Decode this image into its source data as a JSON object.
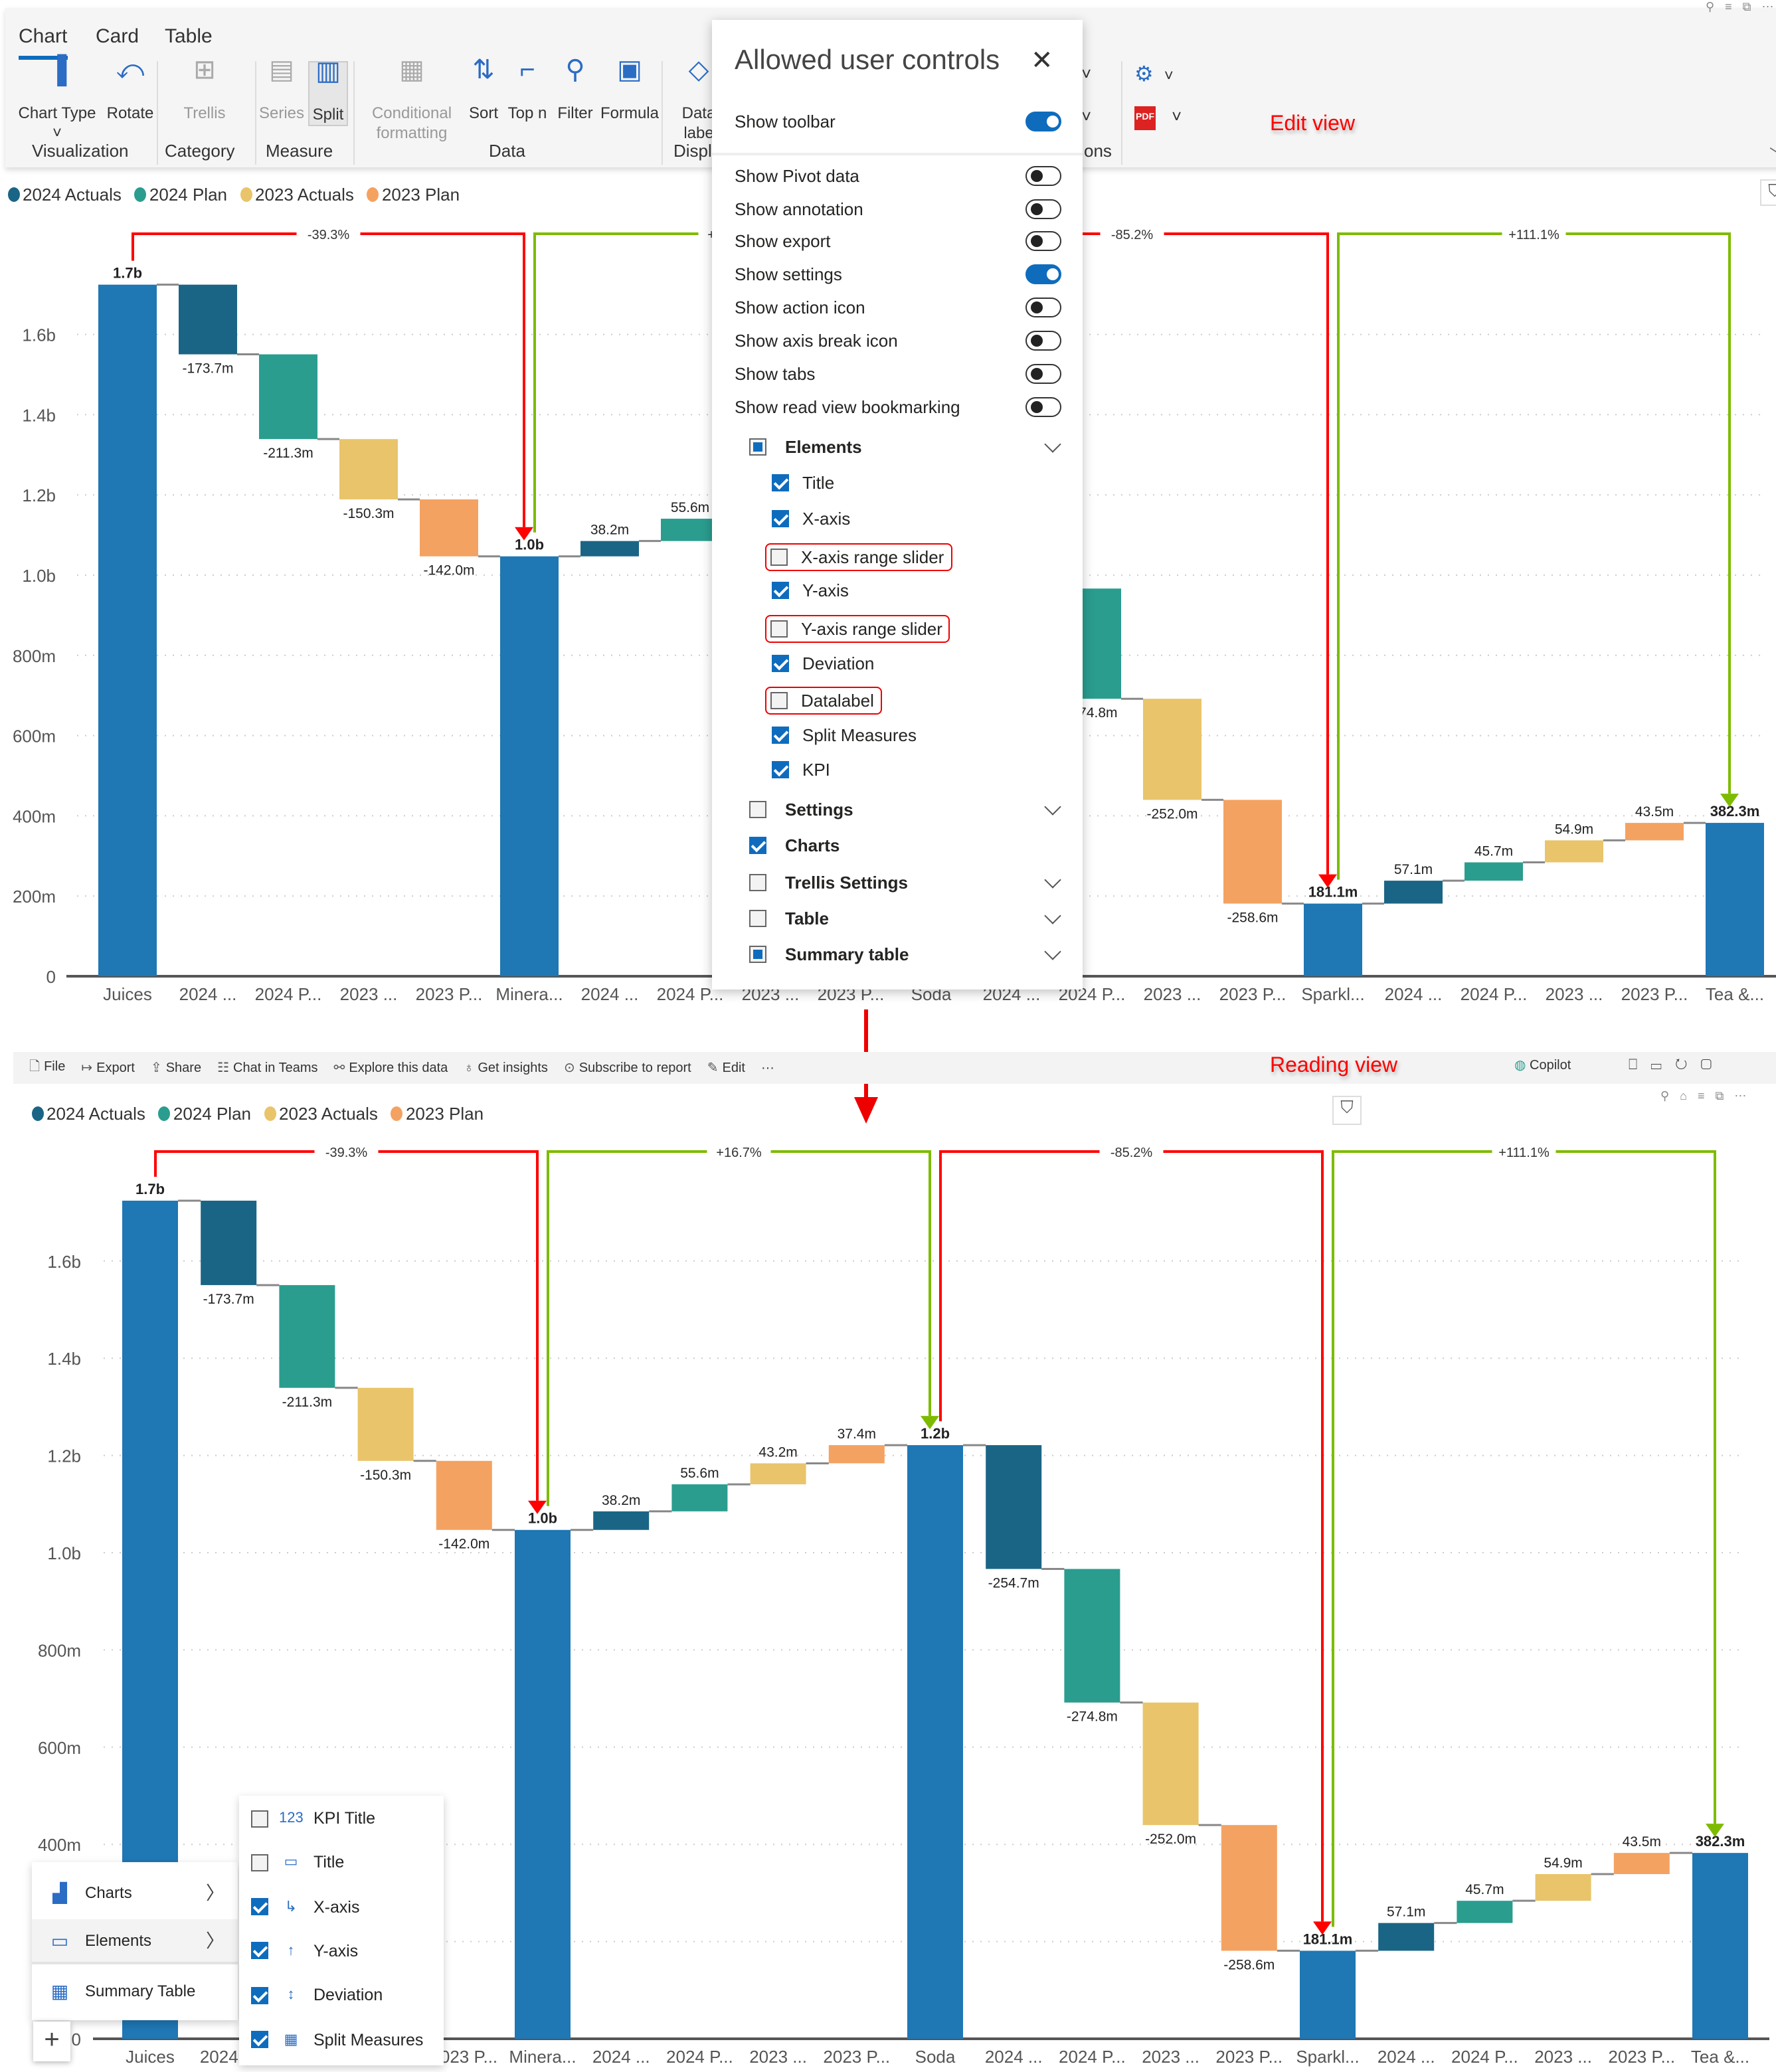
{
  "ribbon": {
    "tabs": [
      "Chart",
      "Card",
      "Table"
    ],
    "active_tab": "Chart",
    "buttons": [
      {
        "label": "Chart Type",
        "icon": "bar-chart-icon",
        "disabled": false
      },
      {
        "label": "Rotate",
        "icon": "rotate-icon",
        "disabled": false
      },
      {
        "label": "Trellis",
        "icon": "trellis-icon",
        "disabled": true
      },
      {
        "label": "Series",
        "icon": "series-icon",
        "disabled": true
      },
      {
        "label": "Split",
        "icon": "split-icon",
        "disabled": false
      },
      {
        "label": "Conditional formatting",
        "icon": "conditional-formatting-icon",
        "disabled": true
      },
      {
        "label": "Sort",
        "icon": "sort-icon",
        "disabled": false
      },
      {
        "label": "Top n",
        "icon": "top-n-icon",
        "disabled": false
      },
      {
        "label": "Filter",
        "icon": "filter-icon",
        "disabled": false
      },
      {
        "label": "Formula",
        "icon": "formula-icon",
        "disabled": false
      },
      {
        "label": "Data labe",
        "icon": "data-label-icon",
        "disabled": false
      }
    ],
    "groups": [
      "Visualization",
      "Category",
      "Measure",
      "Data",
      "Displ",
      "ons"
    ],
    "edit_view_label": "Edit view"
  },
  "legend": [
    {
      "name": "2024 Actuals",
      "color": "#1A6585"
    },
    {
      "name": "2024 Plan",
      "color": "#2A9D8F"
    },
    {
      "name": "2023 Actuals",
      "color": "#E9C46A"
    },
    {
      "name": "2023 Plan",
      "color": "#F4A261"
    }
  ],
  "panel": {
    "title": "Allowed user controls",
    "toggles": [
      {
        "label": "Show toolbar",
        "on": true
      },
      {
        "label": "Show Pivot data",
        "on": false
      },
      {
        "label": "Show annotation",
        "on": false
      },
      {
        "label": "Show export",
        "on": false
      },
      {
        "label": "Show settings",
        "on": true
      },
      {
        "label": "Show action icon",
        "on": false
      },
      {
        "label": "Show axis break icon",
        "on": false
      },
      {
        "label": "Show tabs",
        "on": false
      },
      {
        "label": "Show read view bookmarking",
        "on": false
      }
    ],
    "elements_label": "Elements",
    "elements": [
      {
        "label": "Title",
        "checked": true,
        "highlight": false
      },
      {
        "label": "X-axis",
        "checked": true,
        "highlight": false
      },
      {
        "label": "X-axis range slider",
        "checked": false,
        "highlight": true
      },
      {
        "label": "Y-axis",
        "checked": true,
        "highlight": false
      },
      {
        "label": "Y-axis range slider",
        "checked": false,
        "highlight": true
      },
      {
        "label": "Deviation",
        "checked": true,
        "highlight": false
      },
      {
        "label": "Datalabel",
        "checked": false,
        "highlight": true
      },
      {
        "label": "Split Measures",
        "checked": true,
        "highlight": false
      },
      {
        "label": "KPI",
        "checked": true,
        "highlight": false
      }
    ],
    "sections": [
      {
        "label": "Settings",
        "state": "off",
        "chevron": true
      },
      {
        "label": "Charts",
        "state": "on",
        "chevron": false
      },
      {
        "label": "Trellis Settings",
        "state": "off",
        "chevron": true
      },
      {
        "label": "Table",
        "state": "off",
        "chevron": true
      },
      {
        "label": "Summary table",
        "state": "part",
        "chevron": true
      }
    ]
  },
  "reading_toolbar": {
    "items": [
      "File",
      "Export",
      "Share",
      "Chat in Teams",
      "Explore this data",
      "Get insights",
      "Subscribe to report",
      "Edit",
      "···"
    ],
    "copilot": "Copilot",
    "reading_view_label": "Reading view"
  },
  "context_menu": {
    "items": [
      {
        "label": "Charts",
        "icon": "bar-chart-icon"
      },
      {
        "label": "Elements",
        "icon": "elements-icon"
      },
      {
        "label": "Summary Table",
        "icon": "summary-table-icon"
      }
    ],
    "active": "Elements",
    "submenu": [
      {
        "label": "KPI Title",
        "checked": false,
        "icon": "kpi-icon",
        "glyph": "123"
      },
      {
        "label": "Title",
        "checked": false,
        "icon": "title-icon",
        "glyph": "▭"
      },
      {
        "label": "X-axis",
        "checked": true,
        "icon": "x-axis-icon",
        "glyph": "↳"
      },
      {
        "label": "Y-axis",
        "checked": true,
        "icon": "y-axis-icon",
        "glyph": "↑"
      },
      {
        "label": "Deviation",
        "checked": true,
        "icon": "deviation-icon",
        "glyph": "↕"
      },
      {
        "label": "Split Measures",
        "checked": true,
        "icon": "split-icon",
        "glyph": "▦"
      }
    ],
    "add_label": "+"
  },
  "chart_data": [
    {
      "type": "bar",
      "subtype": "waterfall",
      "view": "edit",
      "categories": [
        "Juices",
        "2024 ...",
        "2024 P...",
        "2023 ...",
        "2023 P...",
        "Minera...",
        "2024 ...",
        "2024 P...",
        "2023 ...",
        "2023 P...",
        "Soda",
        "2024 ...",
        "2024 P...",
        "2023 ...",
        "2023 P...",
        "Sparkl...",
        "2024 ...",
        "2024 P...",
        "2023 ...",
        "2023 P...",
        "Tea &..."
      ],
      "kinds": [
        "total",
        "2024 Actuals",
        "2024 Plan",
        "2023 Actuals",
        "2023 Plan",
        "total",
        "2024 Actuals",
        "2024 Plan",
        "2023 Actuals",
        "2023 Plan",
        "total",
        "2024 Actuals",
        "2024 Plan",
        "2023 Actuals",
        "2023 Plan",
        "total",
        "2024 Actuals",
        "2024 Plan",
        "2023 Actuals",
        "2023 Plan",
        "total"
      ],
      "values": [
        1724.1,
        -173.7,
        -211.3,
        -150.3,
        -142.0,
        1046.8,
        38.2,
        55.6,
        43.2,
        37.4,
        1221.2,
        -254.7,
        -274.8,
        -252.0,
        -258.6,
        181.1,
        57.1,
        45.7,
        54.9,
        43.5,
        382.3
      ],
      "labels": [
        "1.7b",
        "-173.7m",
        "-211.3m",
        "-150.3m",
        "-142.0m",
        "1.0b",
        "38.2m",
        "55.6m",
        "43.2m",
        "37.4m",
        "1.2b",
        "-254.7m",
        "-274.8m",
        "-252.0m",
        "-258.6m",
        "181.1m",
        "57.1m",
        "45.7m",
        "54.9m",
        "43.5m",
        "382.3m"
      ],
      "unit": "millions",
      "ylim": [
        0,
        1750
      ],
      "yticks": [
        0,
        200,
        400,
        600,
        800,
        1000,
        1200,
        1400,
        1600
      ],
      "ytick_labels": [
        "0",
        "200m",
        "400m",
        "600m",
        "800m",
        "1.0b",
        "1.2b",
        "1.4b",
        "1.6b"
      ],
      "total_color": "#1F77B4",
      "deviations": [
        {
          "from": 0,
          "to": 5,
          "label": "-39.3%",
          "color": "#FF0000"
        },
        {
          "from": 5,
          "to": 10,
          "label": "+16.7%",
          "color": "#7DBB00"
        },
        {
          "from": 10,
          "to": 15,
          "label": "-85.2%",
          "color": "#FF0000"
        },
        {
          "from": 15,
          "to": 20,
          "label": "+111.1%",
          "color": "#7DBB00"
        }
      ],
      "grid": true
    },
    {
      "type": "bar",
      "subtype": "waterfall",
      "view": "reading",
      "categories": [
        "Juices",
        "2024 ...",
        "2024 P...",
        "2023 ...",
        "2023 P...",
        "Minera...",
        "2024 ...",
        "2024 P...",
        "2023 ...",
        "2023 P...",
        "Soda",
        "2024 ...",
        "2024 P...",
        "2023 ...",
        "2023 P...",
        "Sparkl...",
        "2024 ...",
        "2024 P...",
        "2023 ...",
        "2023 P...",
        "Tea &..."
      ],
      "kinds": [
        "total",
        "2024 Actuals",
        "2024 Plan",
        "2023 Actuals",
        "2023 Plan",
        "total",
        "2024 Actuals",
        "2024 Plan",
        "2023 Actuals",
        "2023 Plan",
        "total",
        "2024 Actuals",
        "2024 Plan",
        "2023 Actuals",
        "2023 Plan",
        "total",
        "2024 Actuals",
        "2024 Plan",
        "2023 Actuals",
        "2023 Plan",
        "total"
      ],
      "values": [
        1724.1,
        -173.7,
        -211.3,
        -150.3,
        -142.0,
        1046.8,
        38.2,
        55.6,
        43.2,
        37.4,
        1221.2,
        -254.7,
        -274.8,
        -252.0,
        -258.6,
        181.1,
        57.1,
        45.7,
        54.9,
        43.5,
        382.3
      ],
      "labels": [
        "1.7b",
        "-173.7m",
        "-211.3m",
        "-150.3m",
        "-142.0m",
        "1.0b",
        "38.2m",
        "55.6m",
        "43.2m",
        "37.4m",
        "1.2b",
        "-254.7m",
        "-274.8m",
        "-252.0m",
        "-258.6m",
        "181.1m",
        "57.1m",
        "45.7m",
        "54.9m",
        "43.5m",
        "382.3m"
      ],
      "unit": "millions",
      "ylim": [
        0,
        1750
      ],
      "yticks": [
        0,
        200,
        400,
        600,
        800,
        1000,
        1200,
        1400,
        1600
      ],
      "ytick_labels": [
        "0",
        "200m",
        "400m",
        "600m",
        "800m",
        "1.0b",
        "1.2b",
        "1.4b",
        "1.6b"
      ],
      "total_color": "#1F77B4",
      "deviations": [
        {
          "from": 0,
          "to": 5,
          "label": "-39.3%",
          "color": "#FF0000"
        },
        {
          "from": 5,
          "to": 10,
          "label": "+16.7%",
          "color": "#7DBB00"
        },
        {
          "from": 10,
          "to": 15,
          "label": "-85.2%",
          "color": "#FF0000"
        },
        {
          "from": 15,
          "to": 20,
          "label": "+111.1%",
          "color": "#7DBB00"
        }
      ],
      "grid": true
    }
  ]
}
